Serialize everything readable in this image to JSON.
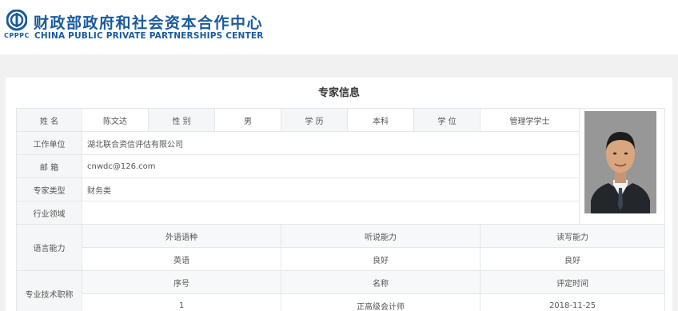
{
  "brand": {
    "abbr": "CPPPC",
    "name_cn": "财政部政府和社会资本合作中心",
    "name_en": "CHINA PUBLIC PRIVATE PARTNERSHIPS CENTER"
  },
  "title": "专家信息",
  "profile": {
    "name_label": "姓 名",
    "name": "陈文达",
    "gender_label": "性 别",
    "gender": "男",
    "education_label": "学 历",
    "education": "本科",
    "degree_label": "学 位",
    "degree": "管理学学士",
    "employer_label": "工作单位",
    "employer": "湖北联合资信评估有限公司",
    "email_label": "邮 箱",
    "email": "cnwdc@126.com",
    "expert_type_label": "专家类型",
    "expert_type": "财务类",
    "industry_label": "行业领域",
    "industry": ""
  },
  "language": {
    "label": "语言能力",
    "headers": [
      "外语语种",
      "听说能力",
      "读写能力"
    ],
    "rows": [
      [
        "英语",
        "良好",
        "良好"
      ]
    ]
  },
  "titles": {
    "label": "专业技术职称",
    "headers": [
      "序号",
      "名称",
      "评定时间"
    ],
    "rows": [
      [
        "1",
        "正高级会计师",
        "2018-11-25"
      ]
    ]
  },
  "colors": {
    "brand_blue": "#1a5a9c",
    "page_bg": "#f1f1f1",
    "label_bg": "#f5f6f7",
    "border": "#e3e7ea"
  }
}
